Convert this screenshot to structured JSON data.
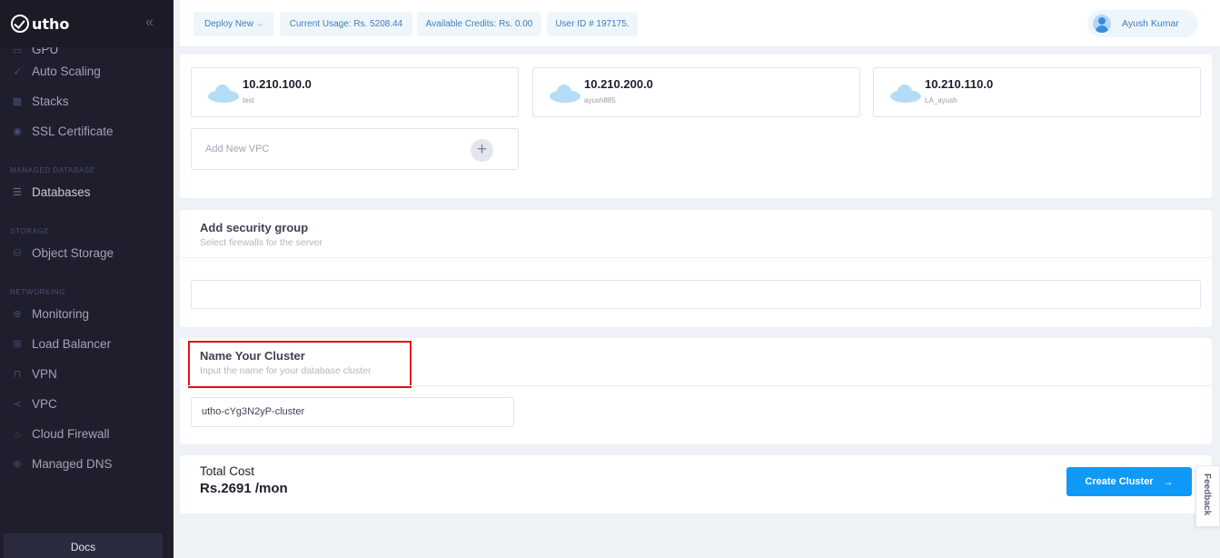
{
  "sidebar": {
    "logo": "utho",
    "collapse_icon": "«",
    "partial_item": "GPU",
    "items_top": [
      {
        "label": "Auto Scaling",
        "icon": "rocket-icon"
      },
      {
        "label": "Stacks",
        "icon": "stack-icon"
      },
      {
        "label": "SSL Certificate",
        "icon": "certificate-icon"
      }
    ],
    "section_db": "MANAGED DATABASE",
    "item_db": {
      "label": "Databases",
      "icon": "database-icon"
    },
    "section_storage": "STORAGE",
    "item_storage": {
      "label": "Object Storage",
      "icon": "object-storage-icon"
    },
    "section_networking": "NETWORKING",
    "items_net": [
      {
        "label": "Monitoring",
        "icon": "globe-icon"
      },
      {
        "label": "Load Balancer",
        "icon": "sitemap-icon"
      },
      {
        "label": "VPN",
        "icon": "lock-icon"
      },
      {
        "label": "VPC",
        "icon": "share-icon"
      },
      {
        "label": "Cloud Firewall",
        "icon": "fire-icon"
      },
      {
        "label": "Managed DNS",
        "icon": "globe-icon"
      }
    ],
    "docs": "Docs"
  },
  "header": {
    "deploy_new": "Deploy New",
    "current_usage": "Current Usage: Rs. 5208.44",
    "available_credits": "Available Credits: Rs. 0.00",
    "user_id": "User ID # 197175.",
    "user_name": "Ayush Kumar"
  },
  "vpc": {
    "tiles": [
      {
        "ip": "10.210.100.0",
        "name": "test"
      },
      {
        "ip": "10.210.200.0",
        "name": "ayush885"
      },
      {
        "ip": "10.210.110.0",
        "name": "LA_ayush"
      }
    ],
    "add_label": "Add New VPC"
  },
  "security_group": {
    "title": "Add security group",
    "subtitle": "Select firewalls for the server",
    "value": ""
  },
  "cluster_name": {
    "title": "Name Your Cluster",
    "subtitle": "Input the name for your database cluster",
    "value": "utho-cYg3N2yP-cluster"
  },
  "cost": {
    "label": "Total Cost",
    "value": "Rs.2691 /mon",
    "button": "Create Cluster"
  },
  "feedback": "Feedback",
  "colors": {
    "accent": "#109af7",
    "sidebar_bg": "#1e1e2d",
    "highlight": "#e01111"
  }
}
